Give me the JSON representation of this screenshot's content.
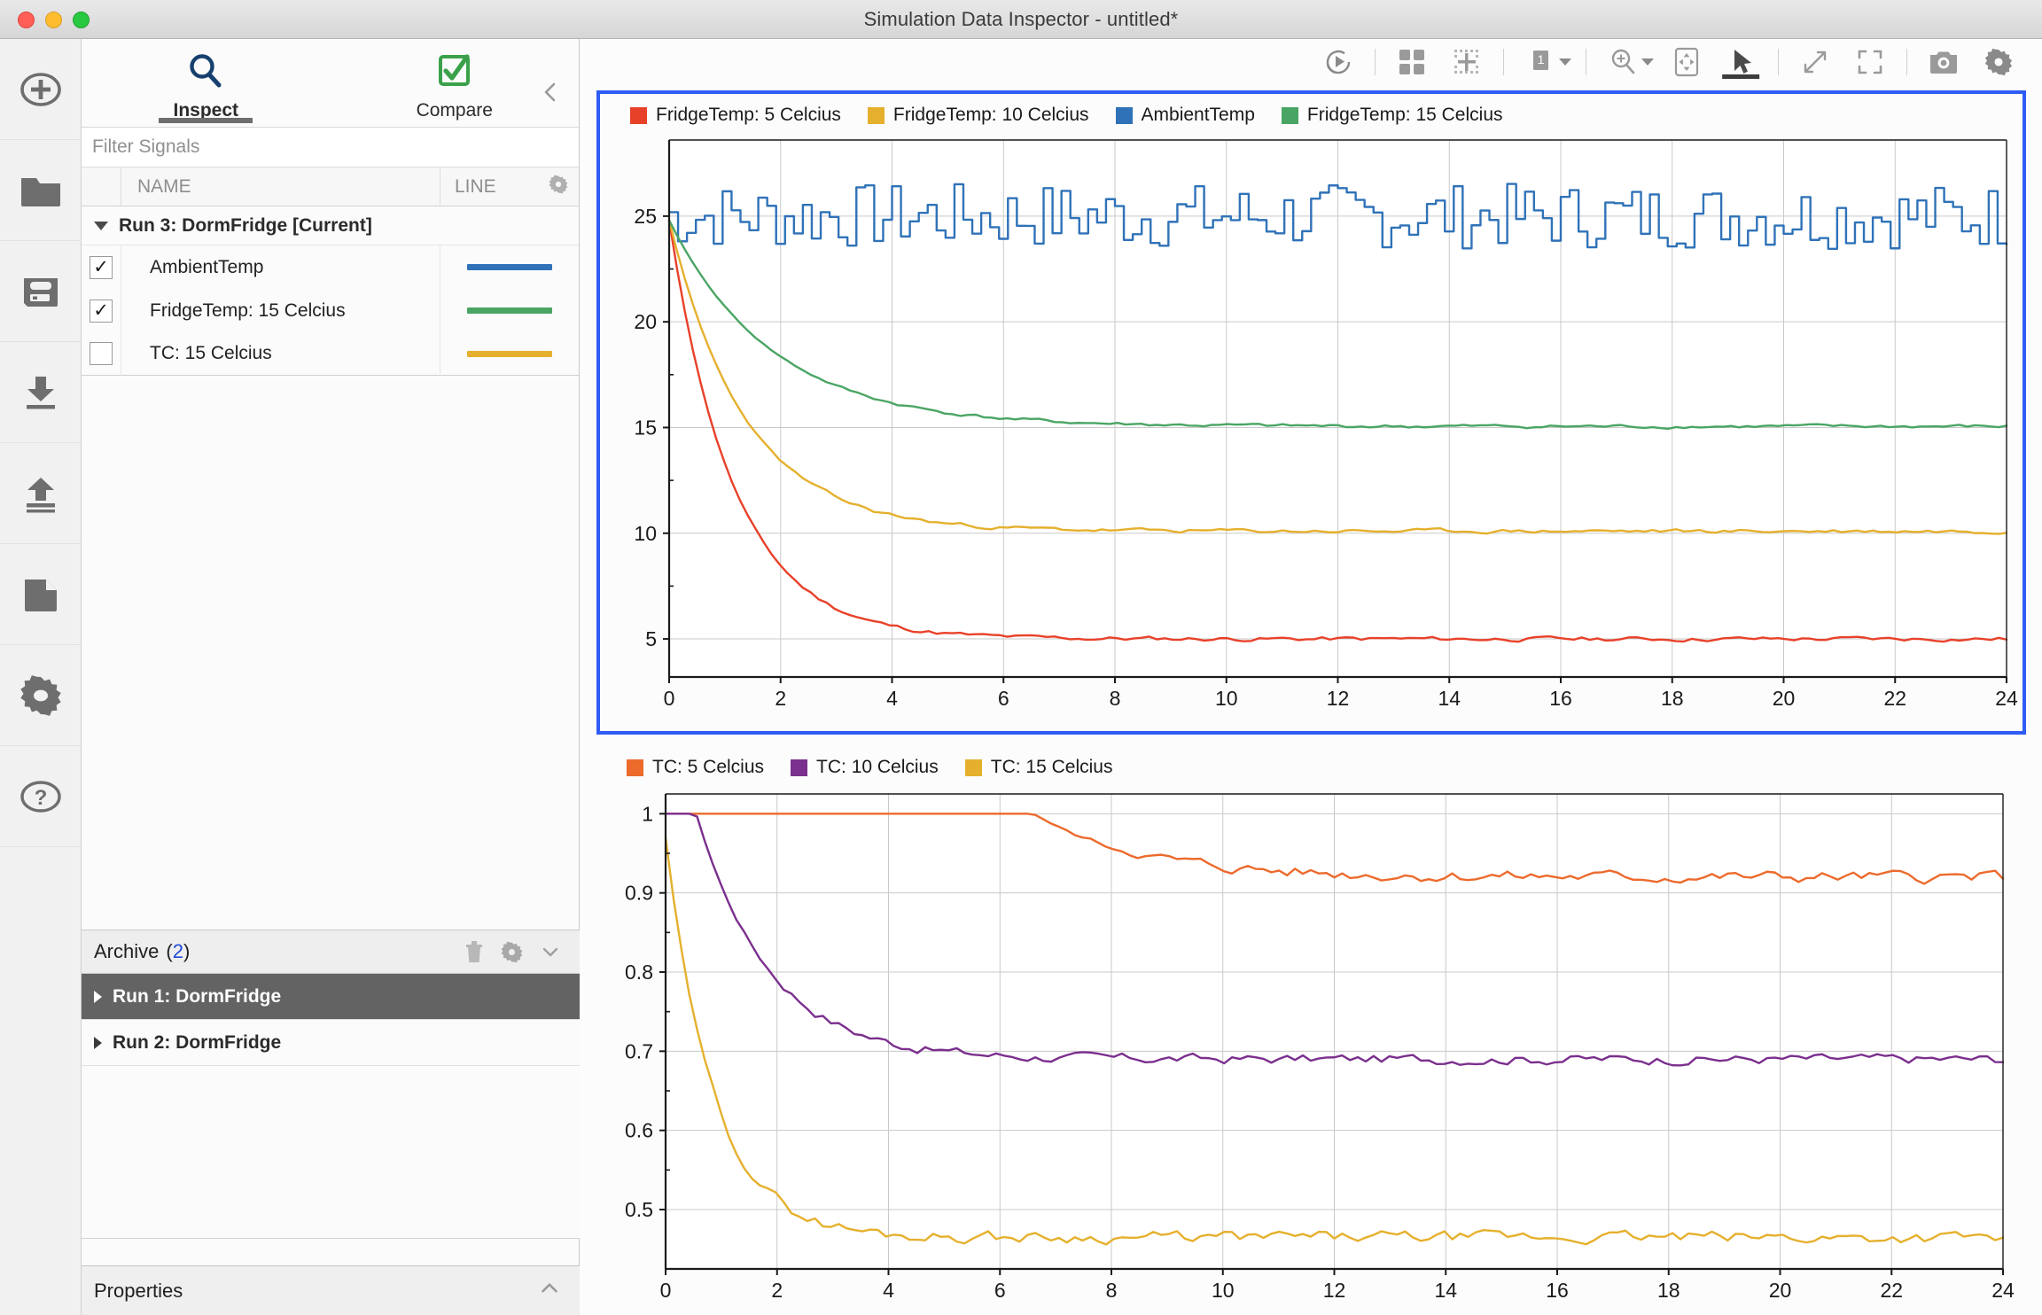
{
  "window": {
    "title": "Simulation Data Inspector - untitled*",
    "controls": [
      "close",
      "minimize",
      "maximize"
    ]
  },
  "rail": {
    "items": [
      {
        "name": "new-run-icon",
        "label": "Add"
      },
      {
        "name": "open-folder-icon",
        "label": "Open"
      },
      {
        "name": "save-icon",
        "label": "Save"
      },
      {
        "name": "import-icon",
        "label": "Import"
      },
      {
        "name": "export-icon",
        "label": "Export"
      },
      {
        "name": "report-icon",
        "label": "Report"
      },
      {
        "name": "gear-icon",
        "label": "Preferences"
      },
      {
        "name": "help-icon",
        "label": "Help"
      }
    ]
  },
  "sidebar": {
    "tabs": [
      {
        "label": "Inspect",
        "icon": "magnifier-icon",
        "active": true
      },
      {
        "label": "Compare",
        "icon": "checkbox-check-icon",
        "active": false
      }
    ],
    "collapse_icon": "chevron-left-icon",
    "filter": {
      "placeholder": "Filter Signals",
      "value": ""
    },
    "columns": {
      "name": "NAME",
      "line": "LINE",
      "settings_icon": "gear-icon"
    },
    "run": {
      "label": "Run 3: DormFridge [Current]",
      "expanded": true,
      "signals": [
        {
          "name": "AmbientTemp",
          "checked": true,
          "color": "#2f72b8"
        },
        {
          "name": "FridgeTemp: 15 Celcius",
          "checked": true,
          "color": "#4aa564"
        },
        {
          "name": "TC: 15 Celcius",
          "checked": false,
          "color": "#e5b02d"
        }
      ]
    },
    "archive": {
      "label": "Archive",
      "count": "2",
      "icons": [
        "trash-icon",
        "gear-icon",
        "chevron-down-icon"
      ],
      "rows": [
        {
          "label": "Run 1: DormFridge",
          "selected": true
        },
        {
          "label": "Run 2: DormFridge",
          "selected": false
        }
      ]
    },
    "properties": {
      "label": "Properties",
      "icon": "chevron-up-icon"
    }
  },
  "toolbar": {
    "buttons": [
      {
        "name": "run-simulation-button",
        "icon": "play-circle-icon"
      },
      {
        "name": "layout-grid-button",
        "icon": "grid-4-icon"
      },
      {
        "name": "subplot-layout-button",
        "icon": "dotted-grid-icon"
      },
      {
        "name": "subplot-count-button",
        "icon": "number-1-icon",
        "value": "1"
      },
      {
        "name": "zoom-in-button",
        "icon": "zoom-in-icon"
      },
      {
        "name": "pan-button",
        "icon": "pan-icon"
      },
      {
        "name": "cursor-button",
        "icon": "arrow-cursor-icon",
        "active": true
      },
      {
        "name": "fit-to-view-button",
        "icon": "diagonal-arrows-icon"
      },
      {
        "name": "fullscreen-button",
        "icon": "expand-brackets-icon"
      },
      {
        "name": "snapshot-button",
        "icon": "camera-icon"
      },
      {
        "name": "settings-button",
        "icon": "gear-icon"
      }
    ]
  },
  "chart_data": [
    {
      "id": "top",
      "type": "line",
      "selected": true,
      "title": "",
      "xlabel": "",
      "ylabel": "",
      "xlim": [
        0,
        24
      ],
      "ylim": [
        3.2,
        28.6
      ],
      "xticks": [
        0,
        2,
        4,
        6,
        8,
        10,
        12,
        14,
        16,
        18,
        20,
        22,
        24
      ],
      "yticks": [
        5,
        10,
        15,
        20,
        25
      ],
      "grid": true,
      "legend_position": "top-left",
      "series": [
        {
          "name": "FridgeTemp: 5 Celcius",
          "color": "#e8412a",
          "style": "smooth-decay",
          "start": 24.8,
          "settle": 5.0,
          "tau": 1.15,
          "noise": 0.2,
          "noise_seed": 11
        },
        {
          "name": "FridgeTemp: 10 Celcius",
          "color": "#e5b02d",
          "style": "smooth-decay",
          "start": 24.8,
          "settle": 10.1,
          "tau": 1.35,
          "noise": 0.18,
          "noise_seed": 23
        },
        {
          "name": "AmbientTemp",
          "color": "#2f72b8",
          "style": "stairs",
          "mean": 25.0,
          "amplitude": 1.55,
          "noise_seed": 7
        },
        {
          "name": "FridgeTemp: 15 Celcius",
          "color": "#4aa564",
          "style": "smooth-decay",
          "start": 24.8,
          "settle": 15.05,
          "tau": 1.85,
          "noise": 0.16,
          "noise_seed": 41
        }
      ]
    },
    {
      "id": "bottom",
      "type": "line",
      "selected": false,
      "title": "",
      "xlabel": "",
      "ylabel": "",
      "xlim": [
        0,
        24
      ],
      "ylim": [
        0.425,
        1.025
      ],
      "xticks": [
        0,
        2,
        4,
        6,
        8,
        10,
        12,
        14,
        16,
        18,
        20,
        22,
        24
      ],
      "yticks": [
        0.5,
        0.6,
        0.7,
        0.8,
        0.9,
        1.0
      ],
      "grid": true,
      "legend_position": "top-left",
      "series": [
        {
          "name": "TC: 5 Celcius",
          "color": "#ec6a2c",
          "style": "delayed-decay",
          "start": 1.0,
          "settle": 0.92,
          "hold": 6.6,
          "tau": 1.9,
          "noise": 0.013,
          "noise_seed": 5
        },
        {
          "name": "TC: 10 Celcius",
          "color": "#7b2f8e",
          "style": "delayed-decay",
          "start": 1.0,
          "settle": 0.69,
          "hold": 0.55,
          "tau": 1.3,
          "noise": 0.011,
          "noise_seed": 17
        },
        {
          "name": "TC: 15 Celcius",
          "color": "#e5b02d",
          "style": "delayed-decay",
          "start": 0.97,
          "settle": 0.465,
          "hold": 0.0,
          "tau": 0.85,
          "noise": 0.013,
          "noise_seed": 29
        }
      ]
    }
  ]
}
